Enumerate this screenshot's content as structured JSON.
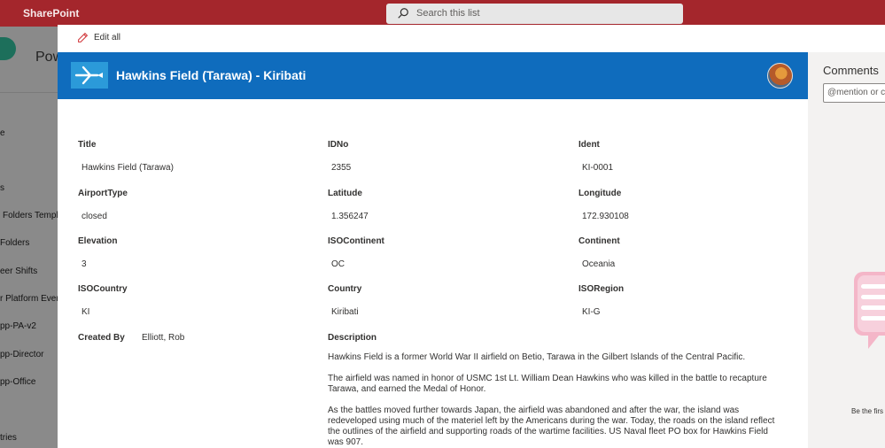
{
  "suite": {
    "brand": "SharePoint",
    "search_placeholder": "Search this list"
  },
  "background": {
    "site_title": "Pow",
    "nav": [
      "e",
      "s",
      "Folders Templ",
      "Folders",
      "eer Shifts",
      "r Platform Even",
      "pp-PA-v2",
      "pp-Director",
      "pp-Office",
      "tries"
    ]
  },
  "panel": {
    "edit_all_label": "Edit all",
    "title": "Hawkins Field (Tarawa) - Kiribati",
    "fields": {
      "title": {
        "label": "Title",
        "value": "Hawkins Field (Tarawa)"
      },
      "idno": {
        "label": "IDNo",
        "value": "2355"
      },
      "ident": {
        "label": "Ident",
        "value": "KI-0001"
      },
      "airport_type": {
        "label": "AirportType",
        "value": "closed"
      },
      "latitude": {
        "label": "Latitude",
        "value": "1.356247"
      },
      "longitude": {
        "label": "Longitude",
        "value": "172.930108"
      },
      "elevation": {
        "label": "Elevation",
        "value": "3"
      },
      "iso_continent": {
        "label": "ISOContinent",
        "value": "OC"
      },
      "continent": {
        "label": "Continent",
        "value": "Oceania"
      },
      "iso_country": {
        "label": "ISOCountry",
        "value": "KI"
      },
      "country": {
        "label": "Country",
        "value": "Kiribati"
      },
      "iso_region": {
        "label": "ISORegion",
        "value": "KI-G"
      },
      "created_by": {
        "label": "Created By",
        "value": "Elliott, Rob"
      },
      "description": {
        "label": "Description",
        "paragraphs": [
          "Hawkins Field is a former World War II airfield on Betio, Tarawa in the Gilbert Islands of the Central Pacific.",
          "The airfield was named in honor of USMC 1st Lt. William Dean Hawkins who was killed in the battle to recapture Tarawa, and earned the Medal of Honor.",
          "As the battles moved further towards Japan, the airfield was abandoned and after the war, the island was redeveloped using much of the materiel left by the Americans during the war. Today, the roads on the island reflect the outlines of the airfield and supporting roads of the wartime facilities. US Naval fleet PO box for Hawkins Field was 907."
        ]
      }
    }
  },
  "comments": {
    "title": "Comments",
    "input_placeholder": "@mention or c",
    "empty_text": "Be the firs"
  },
  "colors": {
    "suite_bar": "#a4262c",
    "header": "#0f6cbd",
    "header_icon": "#2b9ad9"
  }
}
